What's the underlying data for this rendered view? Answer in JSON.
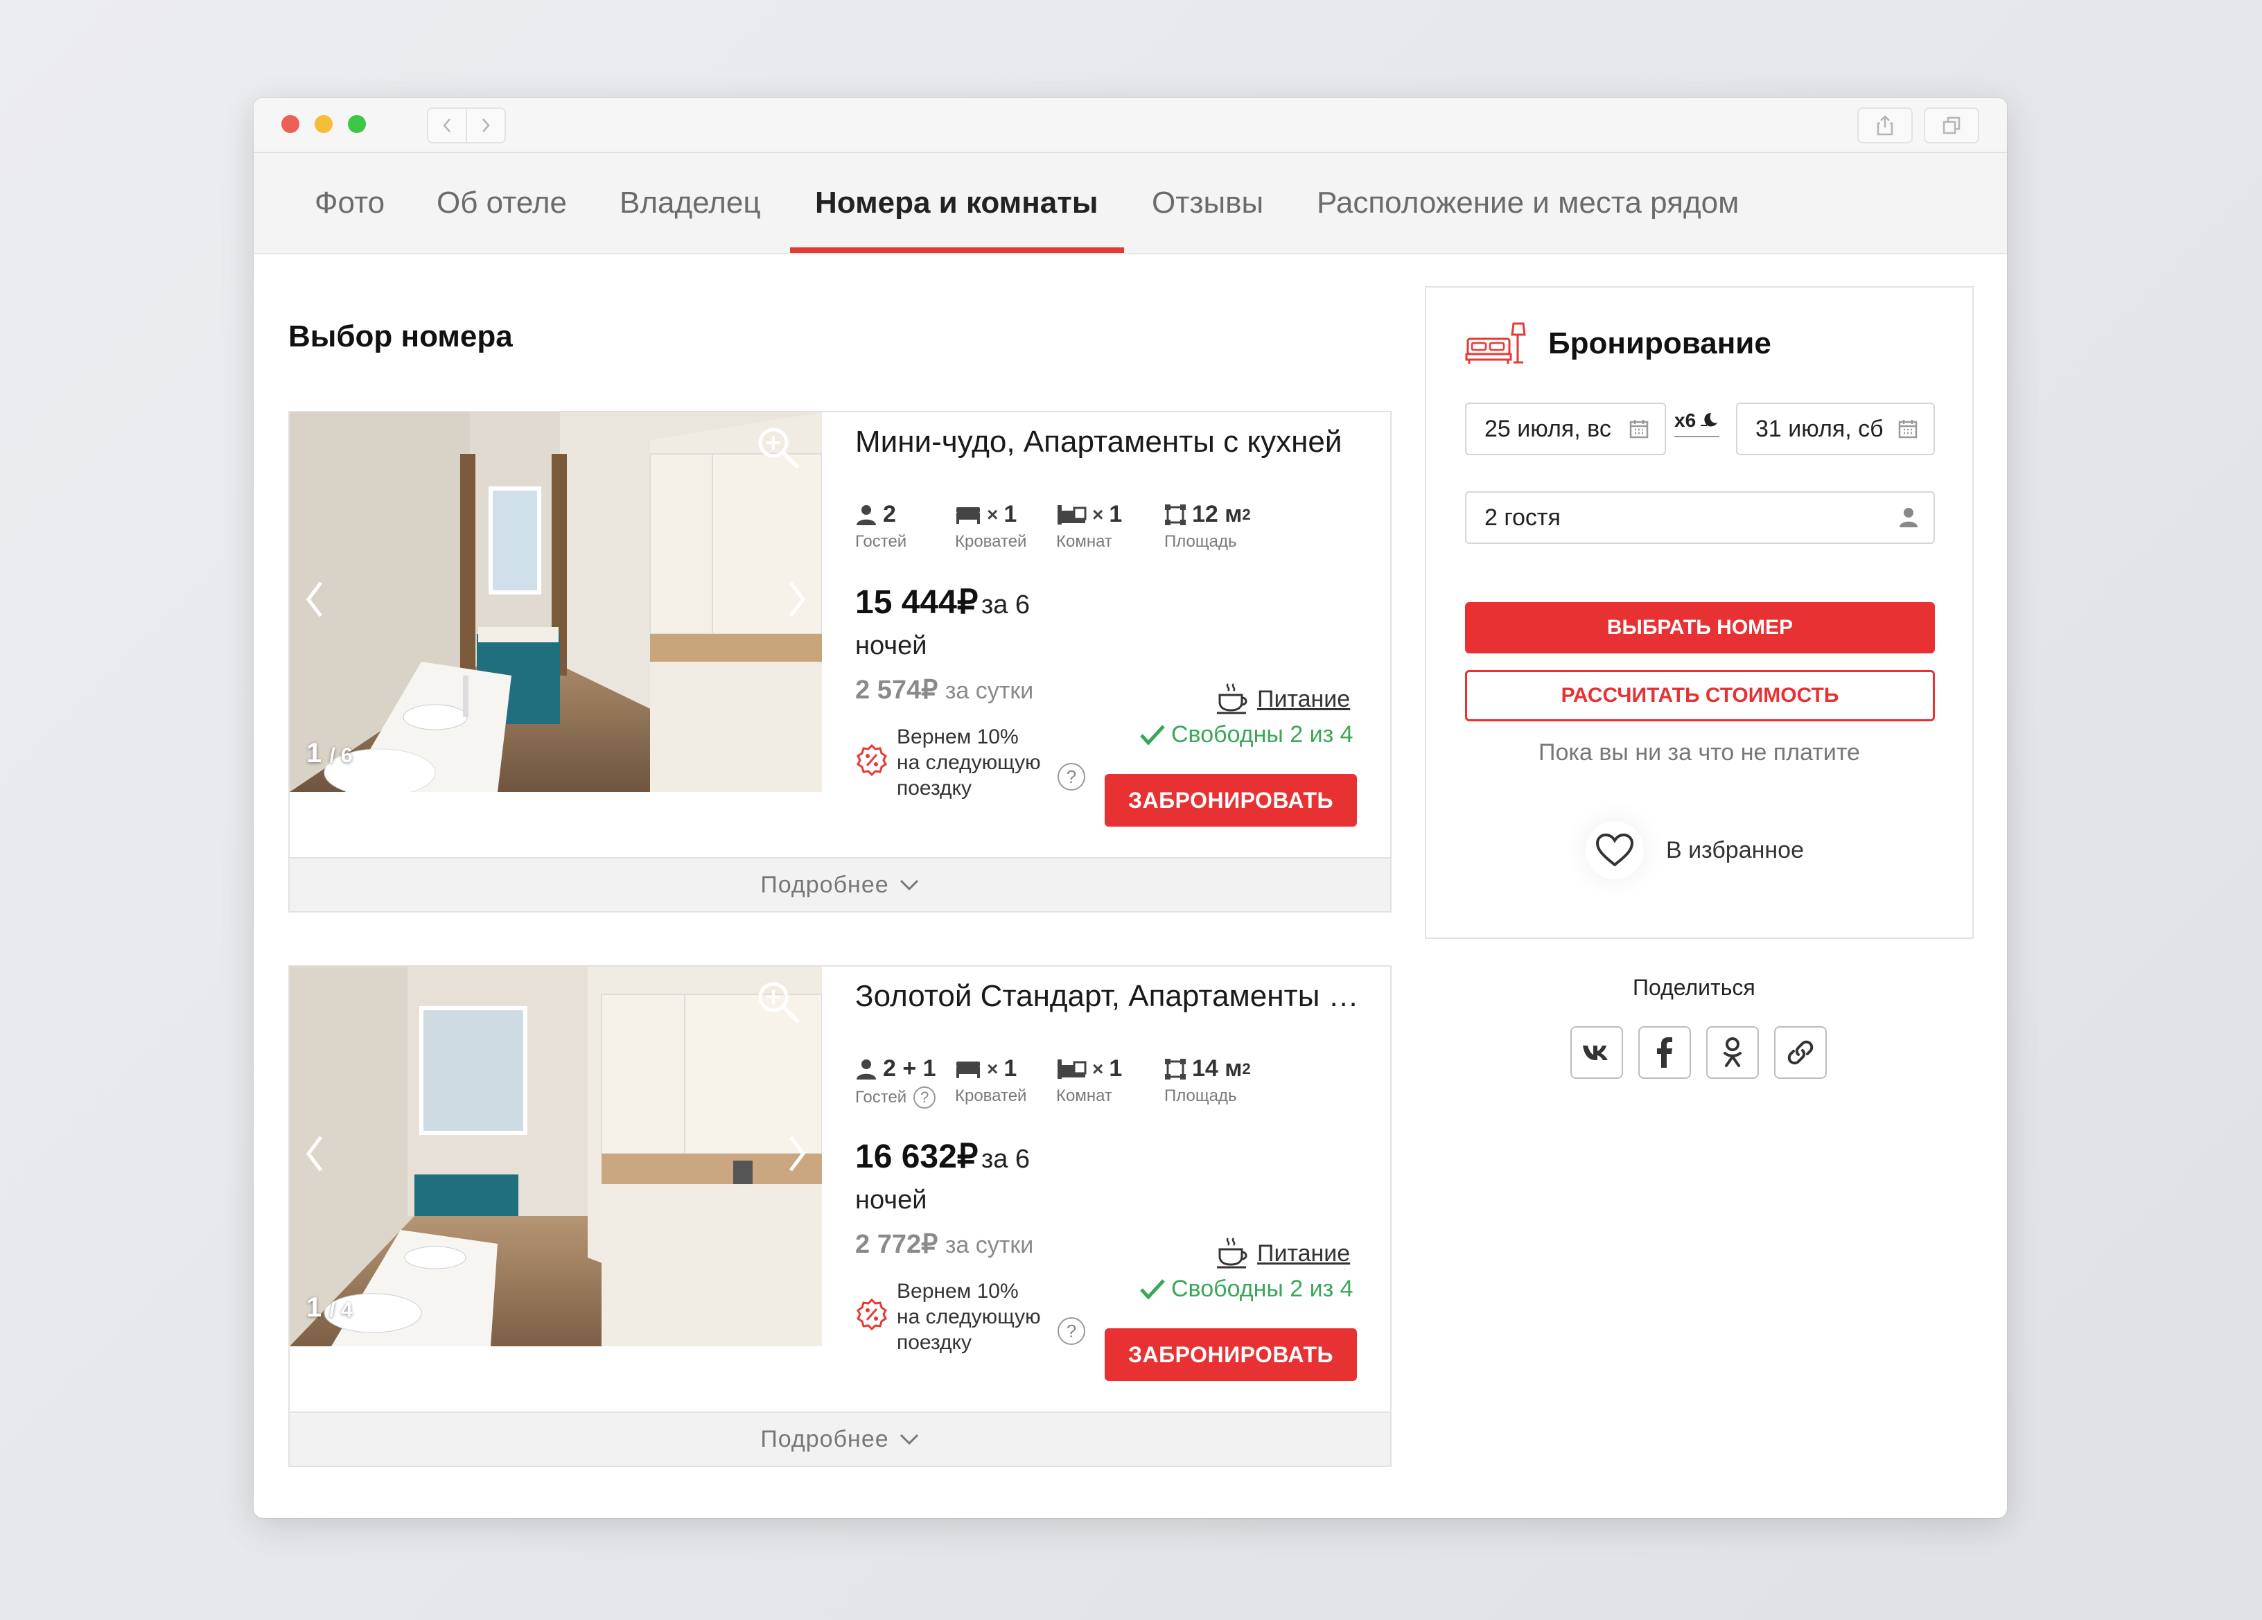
{
  "browser": {
    "back_icon": "chevron-left-icon",
    "forward_icon": "chevron-right-icon",
    "share_icon": "share-icon",
    "tabs_icon": "tabs-icon"
  },
  "tabs": [
    {
      "label": "Фото"
    },
    {
      "label": "Об отеле"
    },
    {
      "label": "Владелец"
    },
    {
      "label": "Номера и комнаты",
      "active": true
    },
    {
      "label": "Отзывы"
    },
    {
      "label": "Расположение и места рядом"
    }
  ],
  "main": {
    "title": "Выбор номера",
    "rooms": [
      {
        "name": "Мини-чудо, Апартаменты с кухней",
        "photo_index": "1",
        "photo_total": "/ 6",
        "guests": "2",
        "guests_label": "Гостей",
        "beds": "1",
        "beds_label": "Кроватей",
        "rooms": "1",
        "rooms_label": "Комнат",
        "area": "12 м",
        "area_sup": "2",
        "area_label": "Площадь",
        "price": "15 444₽",
        "price_for": "за 6",
        "price_nights": "ночей",
        "per_day": "2 574₽",
        "per_day_label": "за сутки",
        "cashback": "Вернем 10% на следующую поездку",
        "food": "Питание",
        "availability": "Свободны 2 из 4",
        "book": "ЗАБРОНИРОВАТЬ",
        "more": "Подробнее"
      },
      {
        "name": "Золотой Стандарт, Апартаменты с кухней",
        "photo_index": "1",
        "photo_total": "/ 4",
        "guests": "2 + 1",
        "guests_label": "Гостей",
        "beds": "1",
        "beds_label": "Кроватей",
        "rooms": "1",
        "rooms_label": "Комнат",
        "area": "14 м",
        "area_sup": "2",
        "area_label": "Площадь",
        "price": "16 632₽",
        "price_for": "за 6",
        "price_nights": "ночей",
        "per_day": "2 772₽",
        "per_day_label": "за сутки",
        "cashback": "Вернем 10% на следующую поездку",
        "food": "Питание",
        "availability": "Свободны 2 из 4",
        "book": "ЗАБРОНИРОВАТЬ",
        "more": "Подробнее"
      }
    ]
  },
  "booking": {
    "title": "Бронирование",
    "checkin": "25 июля, вс",
    "checkout": "31 июля, сб",
    "nights": "x6",
    "guests": "2 гостя",
    "select_button": "ВЫБРАТЬ НОМЕР",
    "calc_button": "РАССЧИТАТЬ СТОИМОСТЬ",
    "no_pay_note": "Пока вы ни за что не платите",
    "favorite": "В избранное"
  },
  "share": {
    "title": "Поделиться",
    "networks": [
      "vk-icon",
      "facebook-icon",
      "odnoklassniki-icon",
      "link-icon"
    ]
  },
  "colors": {
    "accent": "#e83133",
    "available": "#3aa757"
  }
}
